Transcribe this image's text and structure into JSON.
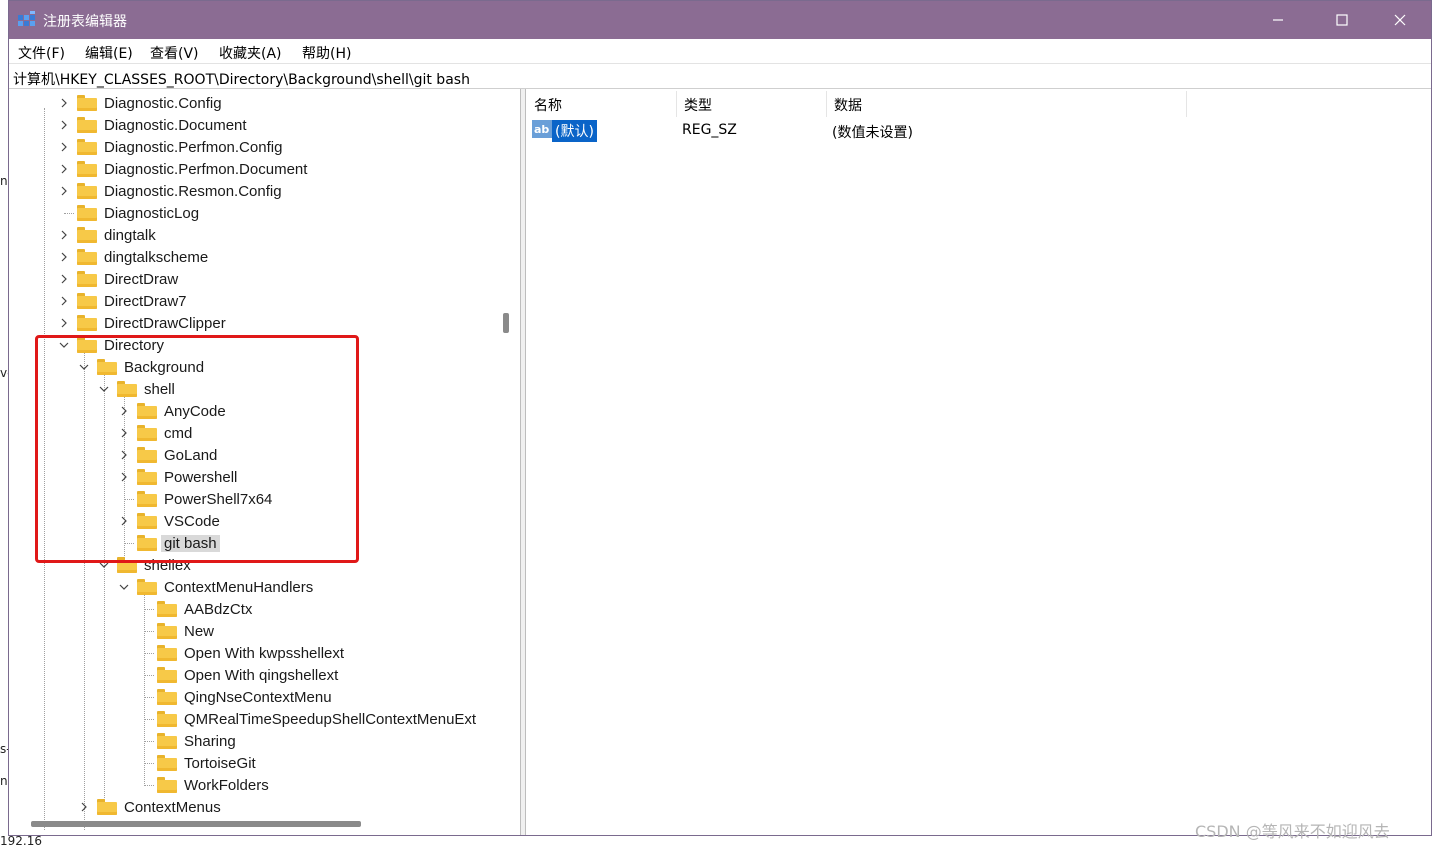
{
  "window": {
    "title": "注册表编辑器"
  },
  "menu": {
    "items": [
      "文件(F)",
      "编辑(E)",
      "查看(V)",
      "收藏夹(A)",
      "帮助(H)"
    ]
  },
  "address": {
    "path": "计算机\\HKEY_CLASSES_ROOT\\Directory\\Background\\shell\\git bash"
  },
  "tree": {
    "items": [
      {
        "label": "Diagnostic.Config",
        "depth": 0,
        "expander": "collapsed"
      },
      {
        "label": "Diagnostic.Document",
        "depth": 0,
        "expander": "collapsed"
      },
      {
        "label": "Diagnostic.Perfmon.Config",
        "depth": 0,
        "expander": "collapsed"
      },
      {
        "label": "Diagnostic.Perfmon.Document",
        "depth": 0,
        "expander": "collapsed"
      },
      {
        "label": "Diagnostic.Resmon.Config",
        "depth": 0,
        "expander": "collapsed"
      },
      {
        "label": "DiagnosticLog",
        "depth": 0,
        "expander": "none"
      },
      {
        "label": "dingtalk",
        "depth": 0,
        "expander": "collapsed"
      },
      {
        "label": "dingtalkscheme",
        "depth": 0,
        "expander": "collapsed"
      },
      {
        "label": "DirectDraw",
        "depth": 0,
        "expander": "collapsed"
      },
      {
        "label": "DirectDraw7",
        "depth": 0,
        "expander": "collapsed"
      },
      {
        "label": "DirectDrawClipper",
        "depth": 0,
        "expander": "collapsed"
      },
      {
        "label": "Directory",
        "depth": 0,
        "expander": "expanded"
      },
      {
        "label": "Background",
        "depth": 1,
        "expander": "expanded"
      },
      {
        "label": "shell",
        "depth": 2,
        "expander": "expanded"
      },
      {
        "label": "AnyCode",
        "depth": 3,
        "expander": "collapsed"
      },
      {
        "label": "cmd",
        "depth": 3,
        "expander": "collapsed"
      },
      {
        "label": "GoLand",
        "depth": 3,
        "expander": "collapsed"
      },
      {
        "label": "Powershell",
        "depth": 3,
        "expander": "collapsed"
      },
      {
        "label": "PowerShell7x64",
        "depth": 3,
        "expander": "none"
      },
      {
        "label": "VSCode",
        "depth": 3,
        "expander": "collapsed"
      },
      {
        "label": "git bash",
        "depth": 3,
        "expander": "none",
        "selected": true
      },
      {
        "label": "shellex",
        "depth": 2,
        "expander": "expanded"
      },
      {
        "label": "ContextMenuHandlers",
        "depth": 3,
        "expander": "expanded"
      },
      {
        "label": "AABdzCtx",
        "depth": 4,
        "expander": "none"
      },
      {
        "label": "New",
        "depth": 4,
        "expander": "none"
      },
      {
        "label": "Open With kwpsshellext",
        "depth": 4,
        "expander": "none"
      },
      {
        "label": "Open With qingshellext",
        "depth": 4,
        "expander": "none"
      },
      {
        "label": "QingNseContextMenu",
        "depth": 4,
        "expander": "none"
      },
      {
        "label": "QMRealTimeSpeedupShellContextMenuExt",
        "depth": 4,
        "expander": "none"
      },
      {
        "label": "Sharing",
        "depth": 4,
        "expander": "none"
      },
      {
        "label": "TortoiseGit",
        "depth": 4,
        "expander": "none"
      },
      {
        "label": "WorkFolders",
        "depth": 4,
        "expander": "none"
      },
      {
        "label": "ContextMenus",
        "depth": 1,
        "expander": "collapsed"
      }
    ]
  },
  "list": {
    "columns": [
      "名称",
      "类型",
      "数据"
    ],
    "rows": [
      {
        "name": "(默认)",
        "type": "REG_SZ",
        "data": "(数值未设置)",
        "icon": "string-value-icon"
      }
    ]
  },
  "watermark": "CSDN @等风来不如迎风去",
  "background_fragments": [
    "nc",
    "ve",
    "s-",
    "n",
    "192.16"
  ],
  "colors": {
    "titlebar": "#8b6c93",
    "highlight": "#e01818",
    "selection": "#0a64c8",
    "folder": "#f7c948"
  }
}
